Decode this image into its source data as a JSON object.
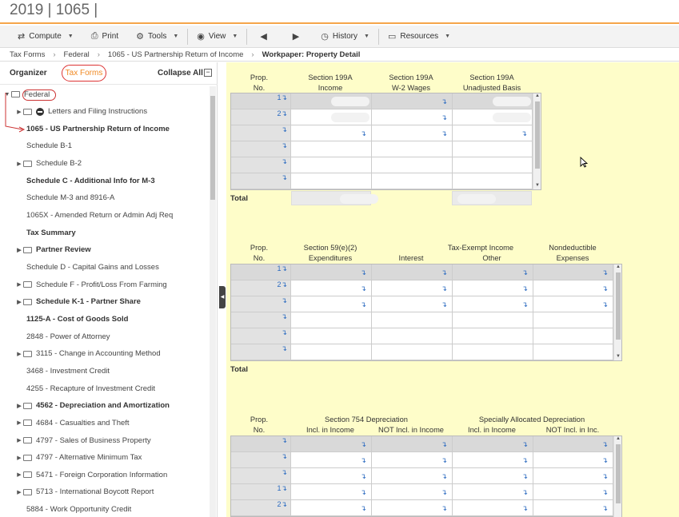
{
  "app": {
    "title": "2019 | 1065 |"
  },
  "toolbar": {
    "compute": "Compute",
    "print": "Print",
    "tools": "Tools",
    "view": "View",
    "history": "History",
    "resources": "Resources"
  },
  "breadcrumb": {
    "items": [
      "Tax Forms",
      "Federal",
      "1065 - US Partnership Return of Income"
    ],
    "current": "Workpaper: Property Detail"
  },
  "left": {
    "organizer": "Organizer",
    "tax_forms": "Tax Forms",
    "collapse_all": "Collapse All",
    "collapse_box": "−",
    "tree": [
      {
        "label": "Federal",
        "bold": false
      },
      {
        "label": "Letters and Filing Instructions",
        "bold": false
      },
      {
        "label": "1065 - US Partnership Return of Income",
        "bold": true
      },
      {
        "label": "Schedule B-1",
        "bold": false
      },
      {
        "label": "Schedule B-2",
        "bold": false
      },
      {
        "label": "Schedule C - Additional Info for M-3",
        "bold": true
      },
      {
        "label": "Schedule M-3 and 8916-A",
        "bold": false
      },
      {
        "label": "1065X - Amended Return or Admin Adj Req",
        "bold": false
      },
      {
        "label": "Tax Summary",
        "bold": true
      },
      {
        "label": "Partner Review",
        "bold": true
      },
      {
        "label": "Schedule D - Capital Gains and Losses",
        "bold": false
      },
      {
        "label": "Schedule F - Profit/Loss From Farming",
        "bold": false
      },
      {
        "label": "Schedule K-1 - Partner Share",
        "bold": true
      },
      {
        "label": "1125-A - Cost of Goods Sold",
        "bold": true
      },
      {
        "label": "2848 - Power of Attorney",
        "bold": false
      },
      {
        "label": "3115 - Change in Accounting Method",
        "bold": false
      },
      {
        "label": "3468 - Investment Credit",
        "bold": false
      },
      {
        "label": "4255 - Recapture of Investment Credit",
        "bold": false
      },
      {
        "label": "4562 - Depreciation and Amortization",
        "bold": true
      },
      {
        "label": "4684 - Casualties and Theft",
        "bold": false
      },
      {
        "label": "4797 - Sales of Business Property",
        "bold": false
      },
      {
        "label": "4797 - Alternative Minimum Tax",
        "bold": false
      },
      {
        "label": "5471 - Foreign Corporation Information",
        "bold": false
      },
      {
        "label": "5713 - International Boycott Report",
        "bold": false
      },
      {
        "label": "5884 - Work Opportunity Credit",
        "bold": false
      }
    ]
  },
  "section1": {
    "headers": [
      {
        "l1": "Prop.",
        "l2": "No."
      },
      {
        "l1": "Section 199A",
        "l2": "Income"
      },
      {
        "l1": "Section 199A",
        "l2": "W-2 Wages"
      },
      {
        "l1": "Section 199A",
        "l2": "Unadjusted Basis"
      }
    ],
    "rows": [
      "1",
      "2",
      "",
      "",
      "",
      ""
    ],
    "total": "Total"
  },
  "section2": {
    "headers": [
      {
        "l1": "Prop.",
        "l2": "No."
      },
      {
        "l1": "Section 59(e)(2)",
        "l2": "Expenditures"
      },
      {
        "l1": "Tax-Exempt Income",
        "l2": ""
      },
      {
        "l1": "",
        "l2": "Interest"
      },
      {
        "l1": "",
        "l2": "Other"
      },
      {
        "l1": "Nondeductible",
        "l2": "Expenses"
      }
    ],
    "rows": [
      "1",
      "2",
      "",
      "",
      "",
      ""
    ],
    "total": "Total"
  },
  "section3": {
    "headers": [
      {
        "l1": "Prop.",
        "l2": "No."
      },
      {
        "l1": "Section 754 Depreciation",
        "l2": ""
      },
      {
        "l1": "",
        "l2": "Incl. in Income"
      },
      {
        "l1": "",
        "l2": "NOT Incl. in Income"
      },
      {
        "l1": "Specially Allocated Depreciation",
        "l2": ""
      },
      {
        "l1": "",
        "l2": "Incl. in Income"
      },
      {
        "l1": "",
        "l2": "NOT Incl. in Inc."
      }
    ],
    "rows": [
      "",
      "",
      "",
      "1",
      "2"
    ]
  },
  "glyphs": {
    "jump": "↴"
  },
  "colors": {
    "accent_orange": "#f5a54a",
    "tab_active": "#f08a24",
    "annotation_red": "#cc3333",
    "panel_yellow": "#fefdc9",
    "link_blue": "#2a6ac0"
  }
}
